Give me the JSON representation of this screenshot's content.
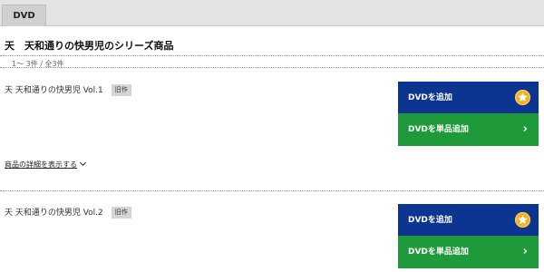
{
  "tabs": [
    {
      "label": "DVD",
      "active": true
    }
  ],
  "page_title": "天　天和通りの快男児のシリーズ商品",
  "result_count": "1～ 3件 / 全3件",
  "items": [
    {
      "title": "天 天和通りの快男児 Vol.1",
      "badge": "旧作",
      "add_label": "DVDを追加",
      "single_label": "DVDを単品追加",
      "detail_label": "商品の詳細を表示する"
    },
    {
      "title": "天 天和通りの快男児 Vol.2",
      "badge": "旧作",
      "add_label": "DVDを追加",
      "single_label": "DVDを単品追加"
    }
  ],
  "icons": {
    "add": "star-icon",
    "single": "chevron-right-icon",
    "detail": "chevron-down-icon"
  },
  "colors": {
    "add_button": "#0c3591",
    "single_button": "#1f9a3a",
    "star": "#f2b223",
    "badge_bg": "#d5d5d5"
  }
}
